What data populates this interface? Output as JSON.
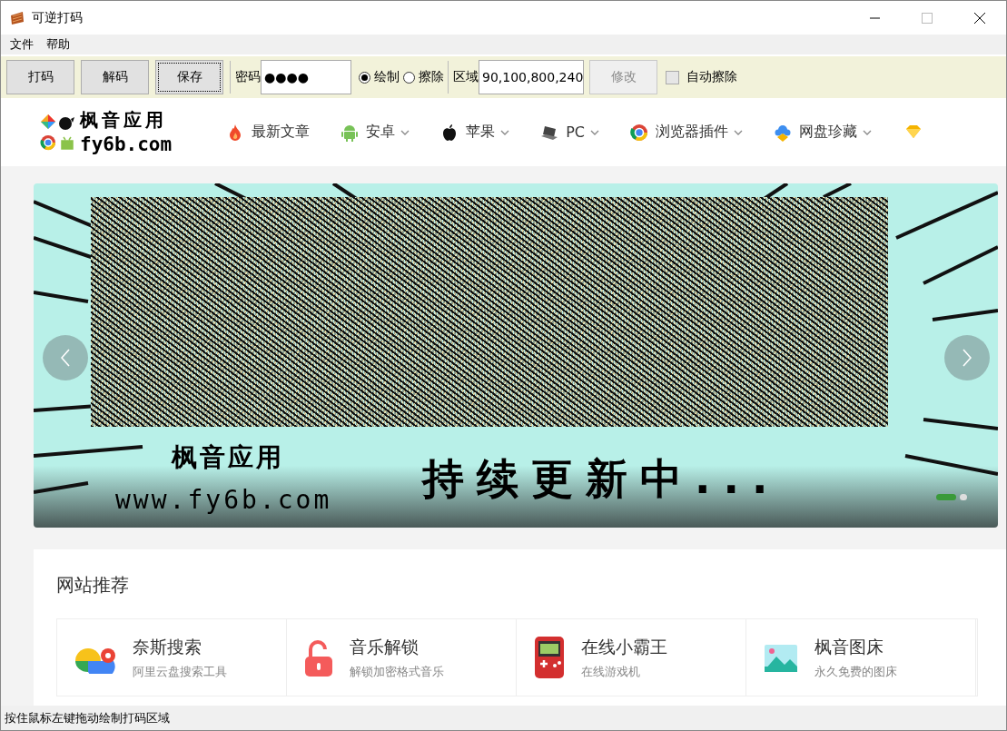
{
  "window": {
    "title": "可逆打码"
  },
  "menu": [
    "文件",
    "帮助"
  ],
  "toolbar": {
    "buttons": [
      {
        "label": "打码",
        "focused": false
      },
      {
        "label": "解码",
        "focused": false
      },
      {
        "label": "保存",
        "focused": true
      }
    ],
    "password": {
      "label": "密码",
      "value": "●●●●"
    },
    "modes": [
      {
        "label": "绘制",
        "selected": true
      },
      {
        "label": "擦除",
        "selected": false
      }
    ],
    "region": {
      "label": "区域",
      "value": "90,100,800,240"
    },
    "apply": {
      "label": "修改",
      "disabled": true
    },
    "auto_erase": {
      "label": "自动擦除",
      "checked": false
    }
  },
  "page": {
    "logo": {
      "name": "枫音应用",
      "domain": "fy6b.com"
    },
    "nav": [
      {
        "label": "最新文章",
        "dropdown": false
      },
      {
        "label": "安卓",
        "dropdown": true
      },
      {
        "label": "苹果",
        "dropdown": true
      },
      {
        "label": "PC",
        "dropdown": true
      },
      {
        "label": "浏览器插件",
        "dropdown": true
      },
      {
        "label": "网盘珍藏",
        "dropdown": true
      }
    ],
    "banner": {
      "brand": "枫音应用",
      "url": "www.fy6b.com",
      "slogan": "持续更新中...",
      "slides": [
        {
          "selected": true
        },
        {
          "selected": false
        }
      ]
    },
    "recommend": {
      "title": "网站推荐",
      "items": [
        {
          "name": "奈斯搜索",
          "desc": "阿里云盘搜索工具"
        },
        {
          "name": "音乐解锁",
          "desc": "解锁加密格式音乐"
        },
        {
          "name": "在线小霸王",
          "desc": "在线游戏机"
        },
        {
          "name": "枫音图床",
          "desc": "永久免费的图床"
        }
      ]
    }
  },
  "status_bar": "按住鼠标左键拖动绘制打码区域"
}
